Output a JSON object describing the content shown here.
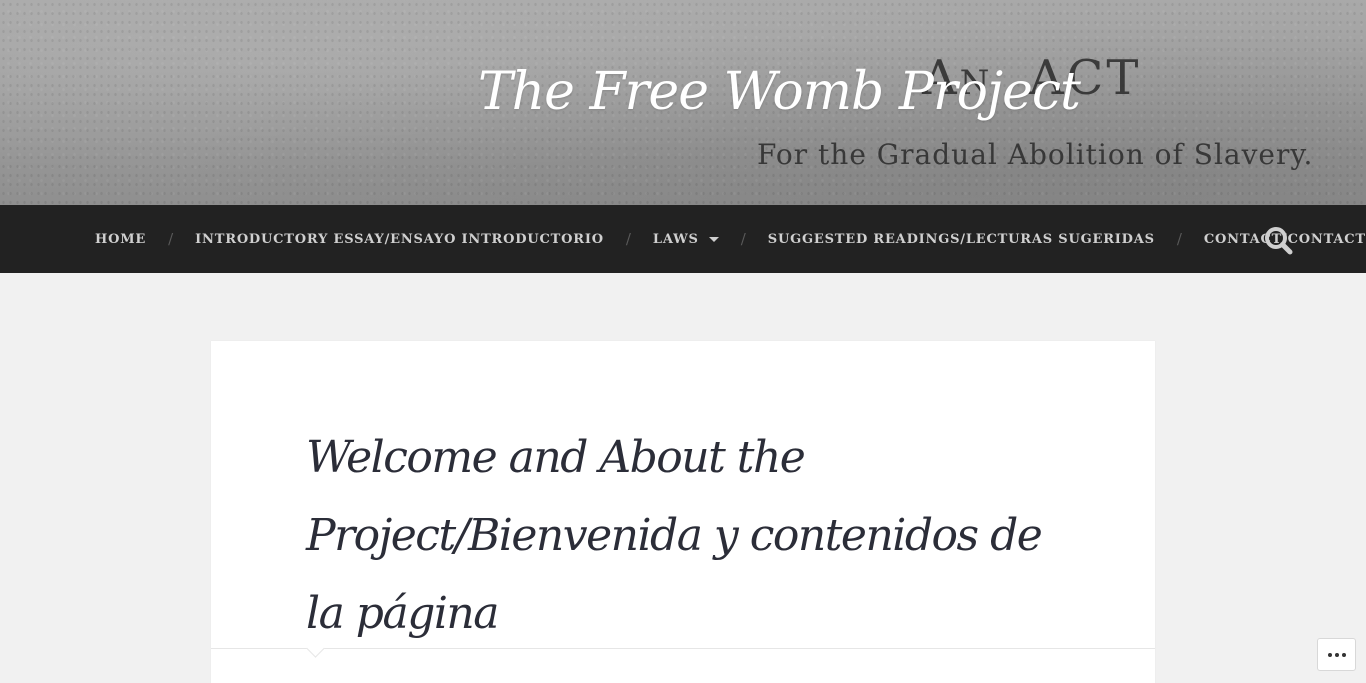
{
  "header": {
    "site_title": "The Free Womb Project",
    "banner_image_text": {
      "act_first": "A",
      "act_smallcaps": "N",
      "act_rest": "ACT",
      "subtitle": "For the Gradual Abolition of Slavery."
    }
  },
  "nav": {
    "items": [
      {
        "label": "HOME"
      },
      {
        "label": "INTRODUCTORY ESSAY/ENSAYO INTRODUCTORIO"
      },
      {
        "label": "LAWS",
        "has_dropdown": true
      },
      {
        "label": "SUGGESTED READINGS/LECTURAS SUGERIDAS"
      },
      {
        "label": "CONTACT/CONTACTO"
      }
    ],
    "separator": "/",
    "search_icon": "search-icon"
  },
  "post": {
    "title": "Welcome and About the Project/Bienvenida y contenidos de la página"
  },
  "floating": {
    "more_icon": "more-dots-icon"
  },
  "colors": {
    "nav_background": "#222222",
    "nav_text": "#cfcfcf",
    "page_background": "#f1f1f1",
    "title_text": "#2b2d38"
  }
}
